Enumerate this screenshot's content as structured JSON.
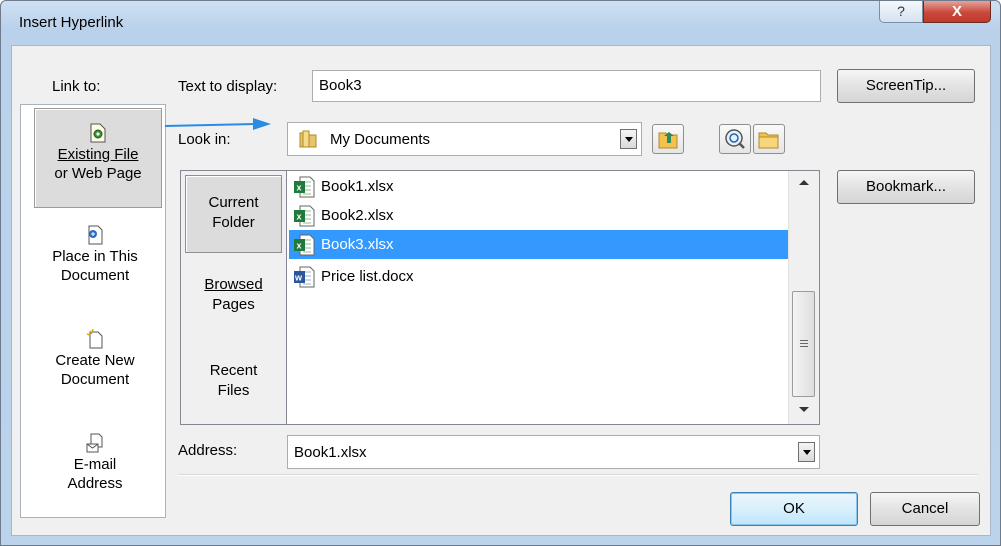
{
  "window": {
    "title": "Insert Hyperlink",
    "help": "?",
    "close": "X"
  },
  "link_to": {
    "label": "Link to:",
    "items": [
      {
        "line1": "Existing File",
        "line2": "or Web Page",
        "icon": "existing-file-icon",
        "selected": true
      },
      {
        "line1": "Place in This",
        "line2": "Document",
        "icon": "place-in-document-icon"
      },
      {
        "line1": "Create New",
        "line2": "Document",
        "icon": "new-document-icon"
      },
      {
        "line1": "E-mail",
        "line2": "Address",
        "icon": "email-icon"
      }
    ]
  },
  "text_to_display": {
    "label": "Text to display:",
    "value": "Book3"
  },
  "look_in": {
    "label": "Look in:",
    "value": "My Documents",
    "folder_icon": "folder-icon"
  },
  "toolbar_icons": [
    "up-folder-icon",
    "browse-web-icon",
    "browse-file-icon"
  ],
  "nav": {
    "items": [
      {
        "line1": "Current",
        "line2": "Folder",
        "selected": true
      },
      {
        "line1": "Browsed",
        "line2": "Pages"
      },
      {
        "line1": "Recent",
        "line2": "Files"
      }
    ]
  },
  "files": [
    {
      "name": "Book1.xlsx",
      "type": "excel"
    },
    {
      "name": "Book2.xlsx",
      "type": "excel"
    },
    {
      "name": "Book3.xlsx",
      "type": "excel",
      "selected": true
    },
    {
      "name": "Price list.docx",
      "type": "word"
    }
  ],
  "address": {
    "label": "Address:",
    "value": "Book1.xlsx"
  },
  "buttons": {
    "screentip": "ScreenTip...",
    "bookmark": "Bookmark...",
    "ok": "OK",
    "cancel": "Cancel"
  },
  "colors": {
    "selection": "#3399ff",
    "arrow": "#2a8be0",
    "excel": "#1f7a3c",
    "word": "#2b579a"
  }
}
